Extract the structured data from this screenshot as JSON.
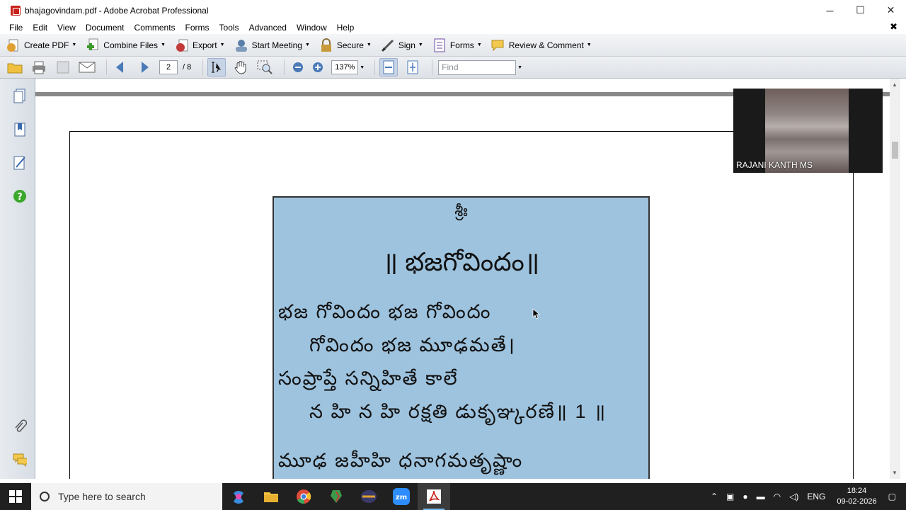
{
  "window": {
    "title": "bhajagovindam.pdf - Adobe Acrobat Professional",
    "controls": {
      "minimize": "─",
      "maximize": "☐",
      "close": "✕"
    }
  },
  "menu": {
    "items": [
      "File",
      "Edit",
      "View",
      "Document",
      "Comments",
      "Forms",
      "Tools",
      "Advanced",
      "Window",
      "Help"
    ],
    "close_glyph": "✖"
  },
  "tasks_toolbar": {
    "create_pdf": "Create PDF",
    "combine_files": "Combine Files",
    "export": "Export",
    "start_meeting": "Start Meeting",
    "secure": "Secure",
    "sign": "Sign",
    "forms": "Forms",
    "review_comment": "Review & Comment"
  },
  "nav_toolbar": {
    "page_current": "2",
    "page_total": "/ 8",
    "zoom": "137%",
    "find_placeholder": "Find"
  },
  "document": {
    "shri": "శ్రీః",
    "heading": "॥ భజగోవిందం॥",
    "lines": [
      "భజ గోవిందం భజ గోవిందం",
      "గోవిందం భజ మూఢమతే।",
      "సంప్రాప్తే సన్నిహితే కాలే",
      "న హి న హి రక్షతి డుకృఞ్కరణే॥ 1 ॥",
      "మూఢ జహీహి ధనాగమతృష్ణాం"
    ]
  },
  "video": {
    "participant": "RAJANI KANTH MS"
  },
  "taskbar": {
    "search_placeholder": "Type here to search",
    "lang": "ENG",
    "time": "18:24",
    "date": "09-02-2026"
  },
  "colors": {
    "content_bg": "#9ec3de",
    "taskbar_bg": "#202020",
    "acrobat_red": "#c8201a"
  }
}
